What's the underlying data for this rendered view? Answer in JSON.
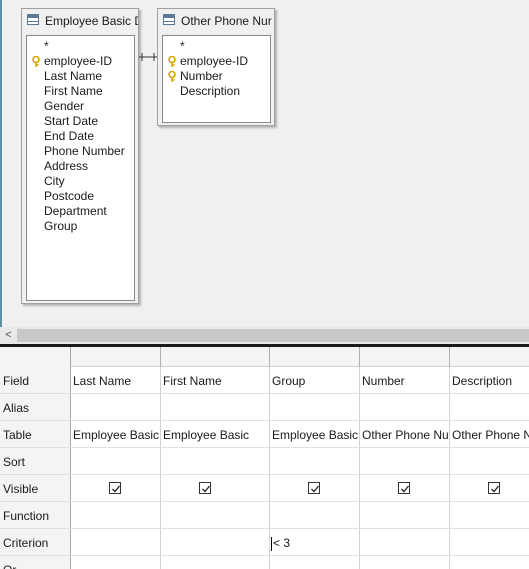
{
  "tables": [
    {
      "title": "Employee Basic D",
      "fields": [
        {
          "name": "*",
          "key": false
        },
        {
          "name": "employee-ID",
          "key": true
        },
        {
          "name": "Last Name",
          "key": false
        },
        {
          "name": "First Name",
          "key": false
        },
        {
          "name": "Gender",
          "key": false
        },
        {
          "name": "Start Date",
          "key": false
        },
        {
          "name": "End Date",
          "key": false
        },
        {
          "name": "Phone Number",
          "key": false
        },
        {
          "name": "Address",
          "key": false
        },
        {
          "name": "City",
          "key": false
        },
        {
          "name": "Postcode",
          "key": false
        },
        {
          "name": "Department",
          "key": false
        },
        {
          "name": "Group",
          "key": false
        }
      ]
    },
    {
      "title": "Other Phone Nur",
      "fields": [
        {
          "name": "*",
          "key": false
        },
        {
          "name": "employee-ID",
          "key": true
        },
        {
          "name": "Number",
          "key": true
        },
        {
          "name": "Description",
          "key": false
        }
      ]
    }
  ],
  "scrollbar": {
    "left_arrow": "<"
  },
  "grid": {
    "row_labels": [
      "Field",
      "Alias",
      "Table",
      "Sort",
      "Visible",
      "Function",
      "Criterion",
      "Or"
    ],
    "columns": [
      {
        "field": "Last Name",
        "alias": "",
        "table": "Employee Basic I",
        "sort": "",
        "visible": true,
        "function": "",
        "criterion": "",
        "or": ""
      },
      {
        "field": "First Name",
        "alias": "",
        "table": "Employee Basic Deta",
        "sort": "",
        "visible": true,
        "function": "",
        "criterion": "",
        "or": ""
      },
      {
        "field": "Group",
        "alias": "",
        "table": "Employee Basic I",
        "sort": "",
        "visible": true,
        "function": "",
        "criterion": "< 3",
        "or": ""
      },
      {
        "field": "Number",
        "alias": "",
        "table": "Other Phone Nu",
        "sort": "",
        "visible": true,
        "function": "",
        "criterion": "",
        "or": ""
      },
      {
        "field": "Description",
        "alias": "",
        "table": "Other Phone N",
        "sort": "",
        "visible": true,
        "function": "",
        "criterion": "",
        "or": ""
      }
    ]
  },
  "colors": {
    "design_background": "#f0f0f0",
    "key_icon": "#d9a400",
    "splitter": "#1a1a1a",
    "left_accent": "#5f8fa8"
  }
}
